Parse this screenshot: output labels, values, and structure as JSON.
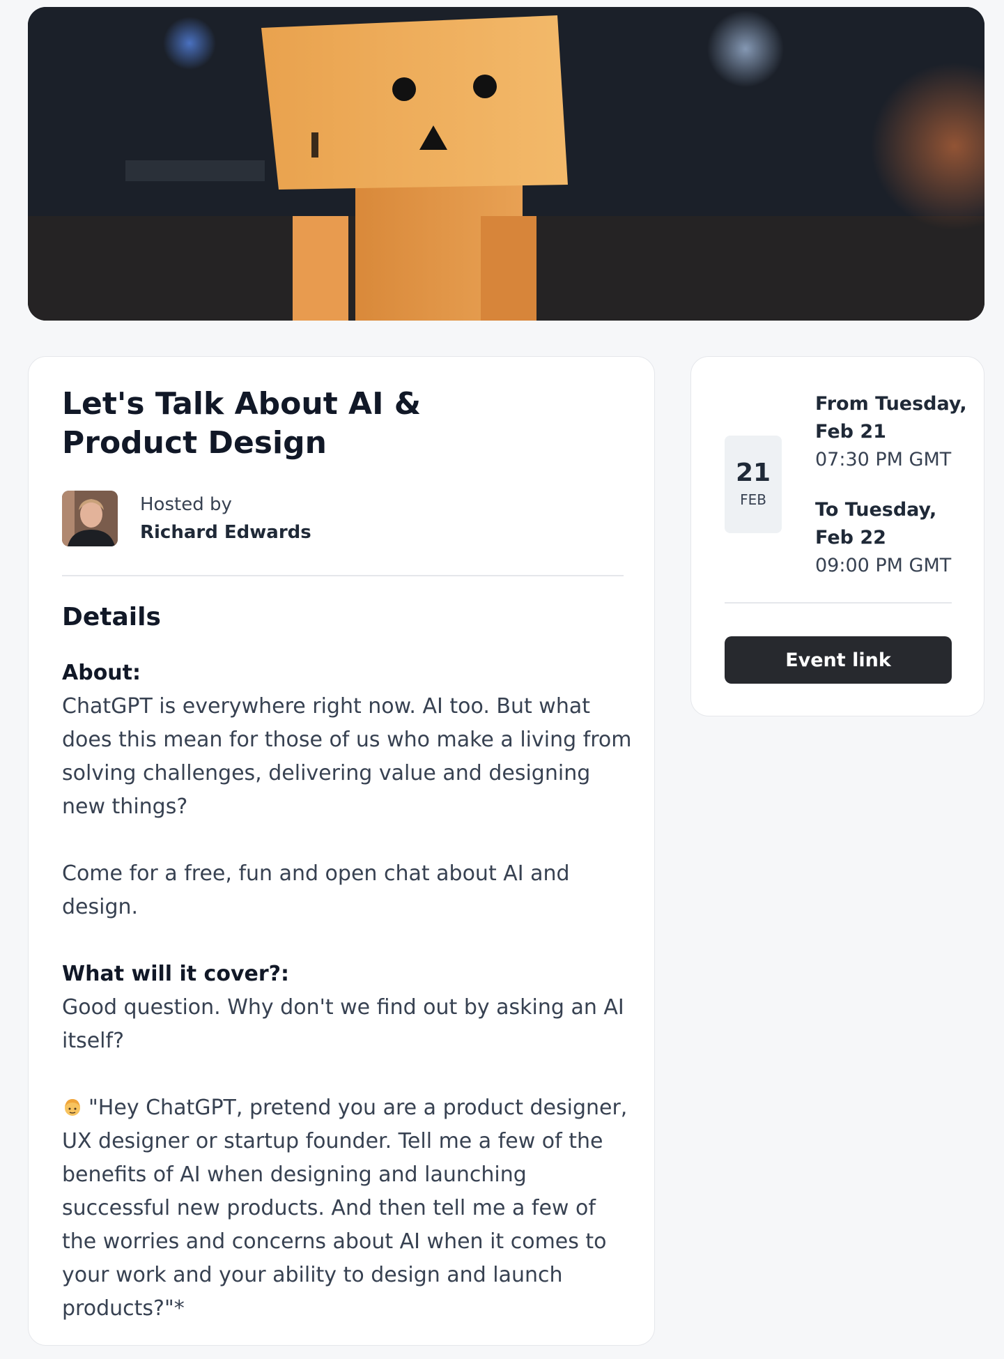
{
  "event": {
    "title": "Let's Talk About AI & Product Design",
    "host": {
      "label": "Hosted by",
      "name": "Richard Edwards"
    }
  },
  "details": {
    "heading": "Details",
    "about_label": "About:",
    "about_text": "ChatGPT is everywhere right now. AI too. But what does this mean for those of us who make a living from solving challenges, delivering value and designing new things?",
    "invite_text": "Come for a free, fun and open chat about AI and design.",
    "cover_label": "What will it cover?:",
    "cover_text": "Good question. Why don't we find out by asking an AI itself?",
    "prompt_emoji": "person-emoji",
    "prompt_text": "\"Hey ChatGPT, pretend you are a product designer, UX designer or startup founder. Tell me a few of the benefits of AI when designing and launching successful new products. And then tell me a few of the worries and concerns about AI when it comes to your work and your ability to design and launch products?\"*"
  },
  "schedule": {
    "day": "21",
    "month": "FEB",
    "from_label": "From Tuesday, Feb 21",
    "from_time": "07:30 PM GMT",
    "to_label": "To Tuesday, Feb 22",
    "to_time": "09:00 PM GMT",
    "event_link_label": "Event link"
  },
  "colors": {
    "page_bg": "#f6f7f9",
    "card_bg": "#ffffff",
    "button_bg": "#27292e",
    "text_primary": "#111827",
    "date_box_bg": "#eef1f4"
  }
}
